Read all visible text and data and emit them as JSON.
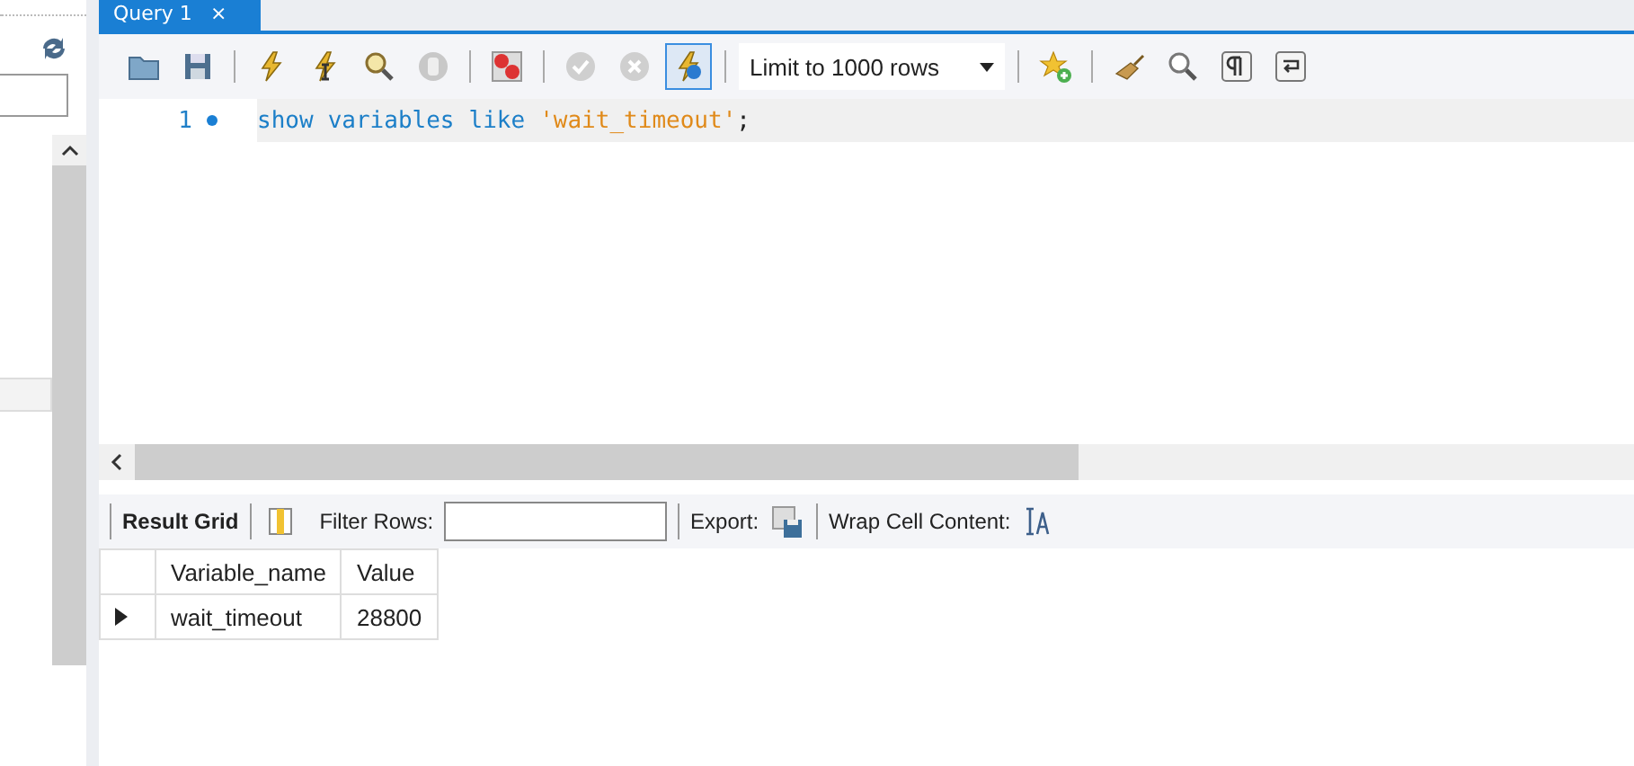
{
  "tab": {
    "label": "Query 1",
    "close": "×"
  },
  "toolbar": {
    "limit": "Limit to 1000 rows",
    "toggle_selected": true
  },
  "editor": {
    "lines": [
      {
        "number": "1",
        "tokens": [
          {
            "kind": "keyword",
            "text": "show"
          },
          {
            "kind": "keyword",
            "text": "variables"
          },
          {
            "kind": "keyword",
            "text": "like"
          },
          {
            "kind": "string",
            "text": "'wait_timeout'"
          },
          {
            "kind": "punct",
            "text": ";"
          }
        ]
      }
    ]
  },
  "result_toolbar": {
    "grid_label": "Result Grid",
    "filter_label": "Filter Rows:",
    "export_label": "Export:",
    "wrap_label": "Wrap Cell Content:"
  },
  "table": {
    "columns": [
      "Variable_name",
      "Value"
    ],
    "rows": [
      {
        "selected": true,
        "cells": [
          "wait_timeout",
          "28800"
        ]
      }
    ]
  }
}
